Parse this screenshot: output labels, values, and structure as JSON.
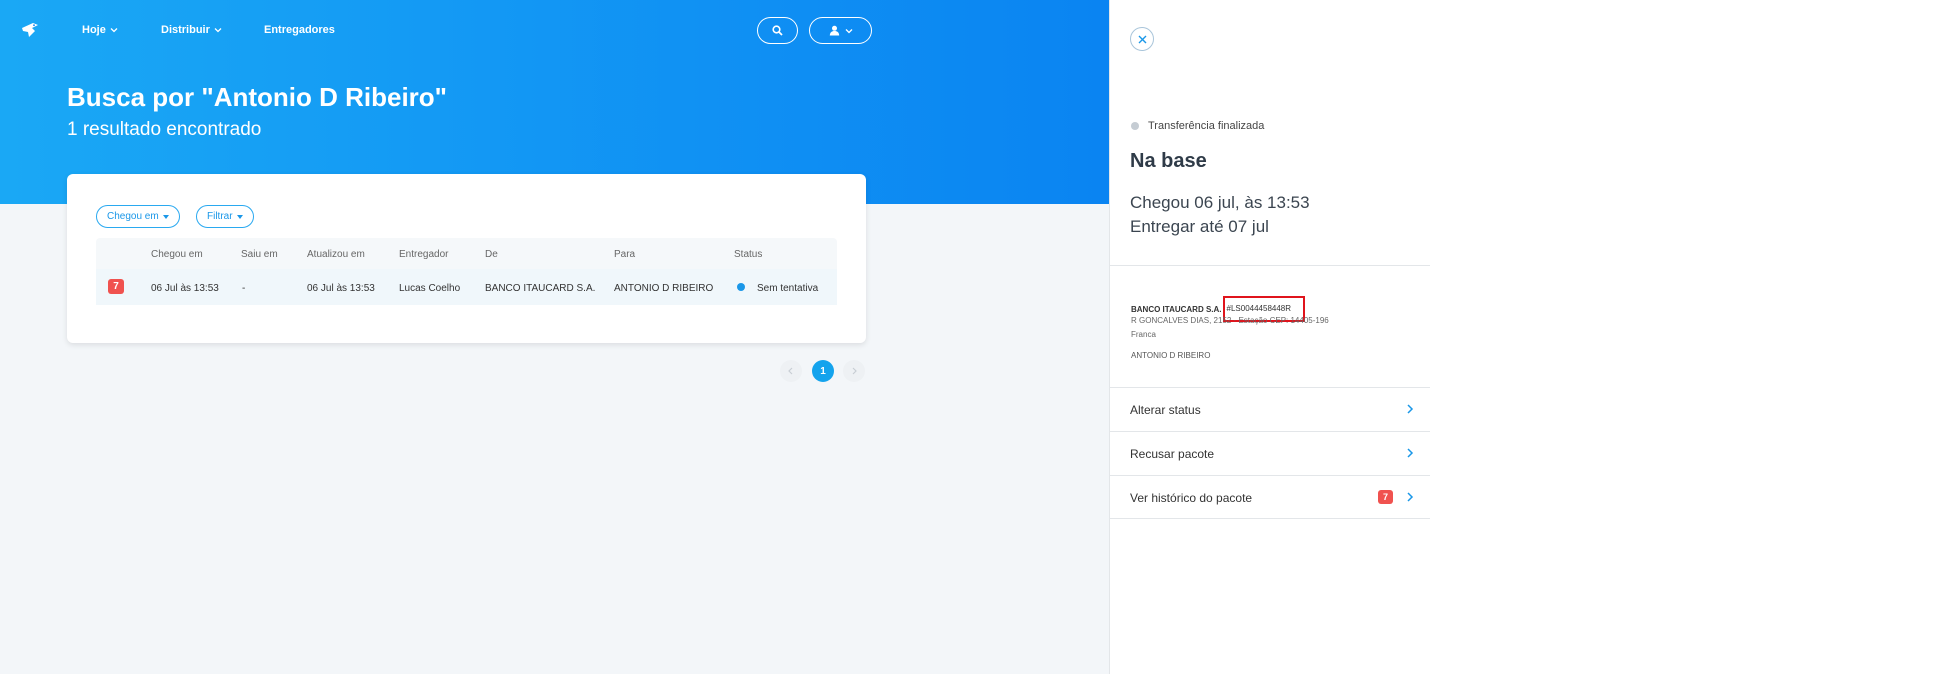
{
  "nav": {
    "items": [
      {
        "label": "Hoje"
      },
      {
        "label": "Distribuir"
      },
      {
        "label": "Entregadores"
      }
    ]
  },
  "search": {
    "title": "Busca por \"Antonio D Ribeiro\"",
    "subtitle": "1 resultado encontrado"
  },
  "filters": {
    "arrived_label": "Chegou em",
    "filter_label": "Filtrar"
  },
  "table": {
    "headers": [
      "Chegou em",
      "Saiu em",
      "Atualizou em",
      "Entregador",
      "De",
      "Para",
      "Status"
    ],
    "rows": [
      {
        "badge": "7",
        "arrived": "06 Jul às 13:53",
        "left": "-",
        "updated": "06 Jul às 13:53",
        "courier": "Lucas Coelho",
        "from": "BANCO ITAUCARD S.A.",
        "to": "ANTONIO D RIBEIRO",
        "status": "Sem tentativa"
      }
    ]
  },
  "pagination": {
    "current": "1"
  },
  "panel": {
    "transfer_status": "Transferência finalizada",
    "title": "Na base",
    "arrived": "Chegou 06 jul, às 13:53",
    "deliver_by": "Entregar até 07 jul",
    "sender": "BANCO ITAUCARD S.A.",
    "tracking": "#LS0044458448R",
    "address_line1": "R GONCALVES DIAS, 2152 · Estação CEP: 14405-196",
    "address_line2": "Franca",
    "recipient": "ANTONIO D RIBEIRO",
    "actions": [
      {
        "label": "Alterar status"
      },
      {
        "label": "Recusar pacote"
      },
      {
        "label": "Ver histórico do pacote",
        "badge": "7"
      }
    ]
  },
  "colors": {
    "brand_blue": "#0a84f2",
    "accent_blue": "#14a3ed",
    "badge_red": "#f0524f",
    "highlight_red": "#e0141c"
  }
}
